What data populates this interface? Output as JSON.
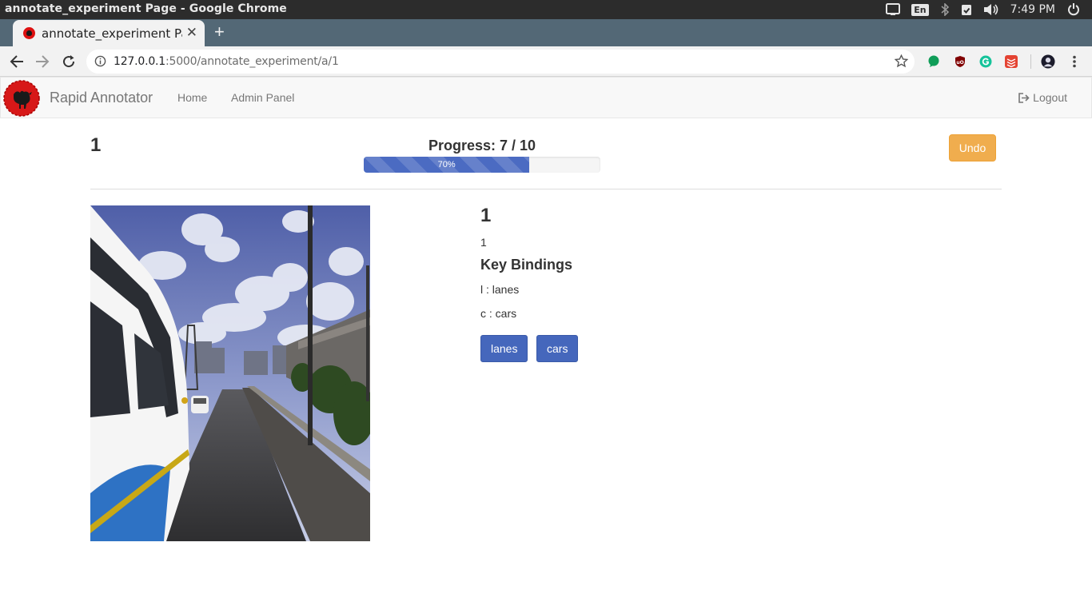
{
  "os": {
    "window_title": "annotate_experiment Page - Google Chrome",
    "keyboard_layout": "En",
    "time": "7:49 PM"
  },
  "browser": {
    "tab_title": "annotate_experiment Page",
    "url_host": "127.0.0.1",
    "url_path": ":5000/annotate_experiment/a/1"
  },
  "navbar": {
    "brand": "Rapid Annotator",
    "links": [
      "Home",
      "Admin Panel"
    ],
    "logout": "Logout"
  },
  "experiment": {
    "name": "1",
    "progress_label": "Progress: 7 / 10",
    "progress_percent": 70,
    "progress_text": "70%",
    "undo_label": "Undo"
  },
  "panel": {
    "title": "1",
    "description": "1",
    "key_bindings_heading": "Key Bindings",
    "bindings": [
      "l : lanes",
      "c : cars"
    ],
    "labels": [
      "lanes",
      "cars"
    ]
  },
  "colors": {
    "progress_bar": "#4b6bc2",
    "undo_button": "#f0ad4e",
    "label_button": "#4567bc",
    "tab_strip": "#536876"
  }
}
